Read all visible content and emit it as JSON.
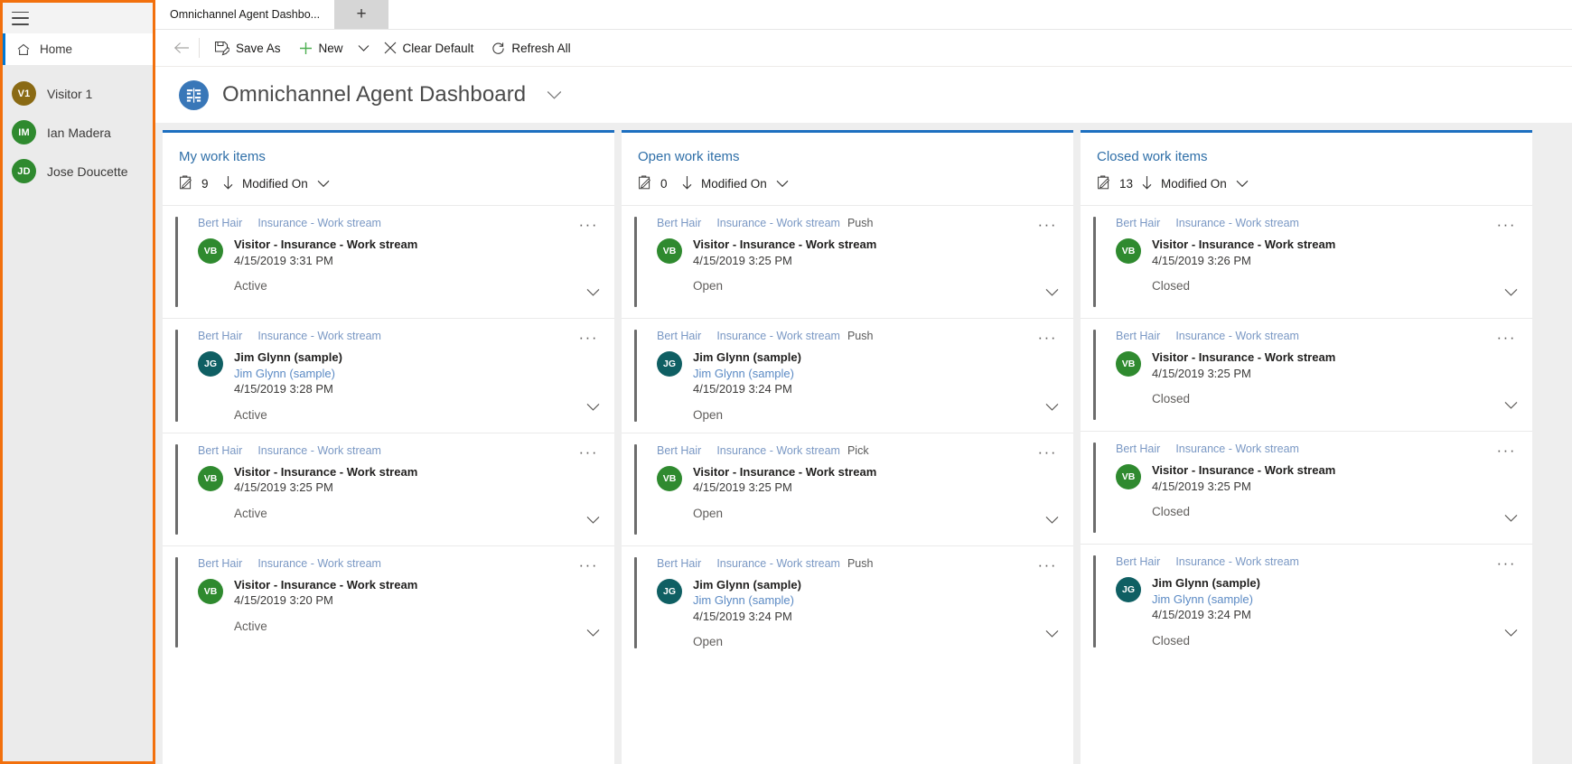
{
  "sidebar": {
    "menu_icon": "hamburger-icon",
    "home": {
      "label": "Home",
      "icon": "home-icon"
    },
    "people": [
      {
        "initials": "V1",
        "name": "Visitor 1",
        "color": "#8a6a14"
      },
      {
        "initials": "IM",
        "name": "Ian Madera",
        "color": "#2f8a2f"
      },
      {
        "initials": "JD",
        "name": "Jose Doucette",
        "color": "#2f8a2f"
      }
    ]
  },
  "tabs": {
    "items": [
      {
        "label": "Omnichannel Agent Dashbo..."
      }
    ],
    "new_tab_label": "+"
  },
  "commandbar": {
    "back_icon": "back-arrow-icon",
    "save_as": "Save As",
    "new": "New",
    "new_caret": "chevron-down-icon",
    "clear_default": "Clear Default",
    "refresh_all": "Refresh All"
  },
  "page": {
    "title": "Omnichannel Agent Dashboard",
    "title_caret": "chevron-down-icon",
    "badge_icon": "dashboard-icon",
    "accent_color": "#1d6fc0"
  },
  "columns": [
    {
      "title": "My work items",
      "count": "9",
      "sort_by": "Modified On",
      "cards": [
        {
          "agent": "Bert Hair",
          "stream": "Insurance - Work stream",
          "mode": "",
          "initials": "VB",
          "avatar_color": "#2f8a2f",
          "title": "Visitor - Insurance - Work stream",
          "subtitle": "",
          "time": "4/15/2019 3:31 PM",
          "status": "Active"
        },
        {
          "agent": "Bert Hair",
          "stream": "Insurance - Work stream",
          "mode": "",
          "initials": "JG",
          "avatar_color": "#0f5f63",
          "title": "Jim Glynn (sample)",
          "subtitle": "Jim Glynn (sample)",
          "time": "4/15/2019 3:28 PM",
          "status": "Active"
        },
        {
          "agent": "Bert Hair",
          "stream": "Insurance - Work stream",
          "mode": "",
          "initials": "VB",
          "avatar_color": "#2f8a2f",
          "title": "Visitor - Insurance - Work stream",
          "subtitle": "",
          "time": "4/15/2019 3:25 PM",
          "status": "Active"
        },
        {
          "agent": "Bert Hair",
          "stream": "Insurance - Work stream",
          "mode": "",
          "initials": "VB",
          "avatar_color": "#2f8a2f",
          "title": "Visitor - Insurance - Work stream",
          "subtitle": "",
          "time": "4/15/2019 3:20 PM",
          "status": "Active"
        }
      ]
    },
    {
      "title": "Open work items",
      "count": "0",
      "sort_by": "Modified On",
      "cards": [
        {
          "agent": "Bert Hair",
          "stream": "Insurance - Work stream",
          "mode": "Push",
          "initials": "VB",
          "avatar_color": "#2f8a2f",
          "title": "Visitor - Insurance - Work stream",
          "subtitle": "",
          "time": "4/15/2019 3:25 PM",
          "status": "Open"
        },
        {
          "agent": "Bert Hair",
          "stream": "Insurance - Work stream",
          "mode": "Push",
          "initials": "JG",
          "avatar_color": "#0f5f63",
          "title": "Jim Glynn (sample)",
          "subtitle": "Jim Glynn (sample)",
          "time": "4/15/2019 3:24 PM",
          "status": "Open"
        },
        {
          "agent": "Bert Hair",
          "stream": "Insurance - Work stream",
          "mode": "Pick",
          "initials": "VB",
          "avatar_color": "#2f8a2f",
          "title": "Visitor - Insurance - Work stream",
          "subtitle": "",
          "time": "4/15/2019 3:25 PM",
          "status": "Open"
        },
        {
          "agent": "Bert Hair",
          "stream": "Insurance - Work stream",
          "mode": "Push",
          "initials": "JG",
          "avatar_color": "#0f5f63",
          "title": "Jim Glynn (sample)",
          "subtitle": "Jim Glynn (sample)",
          "time": "4/15/2019 3:24 PM",
          "status": "Open"
        }
      ]
    },
    {
      "title": "Closed work items",
      "count": "13",
      "sort_by": "Modified On",
      "cards": [
        {
          "agent": "Bert Hair",
          "stream": "Insurance - Work stream",
          "mode": "",
          "initials": "VB",
          "avatar_color": "#2f8a2f",
          "title": "Visitor - Insurance - Work stream",
          "subtitle": "",
          "time": "4/15/2019 3:26 PM",
          "status": "Closed"
        },
        {
          "agent": "Bert Hair",
          "stream": "Insurance - Work stream",
          "mode": "",
          "initials": "VB",
          "avatar_color": "#2f8a2f",
          "title": "Visitor - Insurance - Work stream",
          "subtitle": "",
          "time": "4/15/2019 3:25 PM",
          "status": "Closed"
        },
        {
          "agent": "Bert Hair",
          "stream": "Insurance - Work stream",
          "mode": "",
          "initials": "VB",
          "avatar_color": "#2f8a2f",
          "title": "Visitor - Insurance - Work stream",
          "subtitle": "",
          "time": "4/15/2019 3:25 PM",
          "status": "Closed"
        },
        {
          "agent": "Bert Hair",
          "stream": "Insurance - Work stream",
          "mode": "",
          "initials": "JG",
          "avatar_color": "#0f5f63",
          "title": "Jim Glynn (sample)",
          "subtitle": "Jim Glynn (sample)",
          "time": "4/15/2019 3:24 PM",
          "status": "Closed"
        }
      ]
    }
  ],
  "icons": {
    "work_item_icon": "clipboard-icon",
    "sort_desc_icon": "arrow-down-icon",
    "overflow_icon": "ellipsis-icon",
    "expand_icon": "chevron-down-icon"
  }
}
